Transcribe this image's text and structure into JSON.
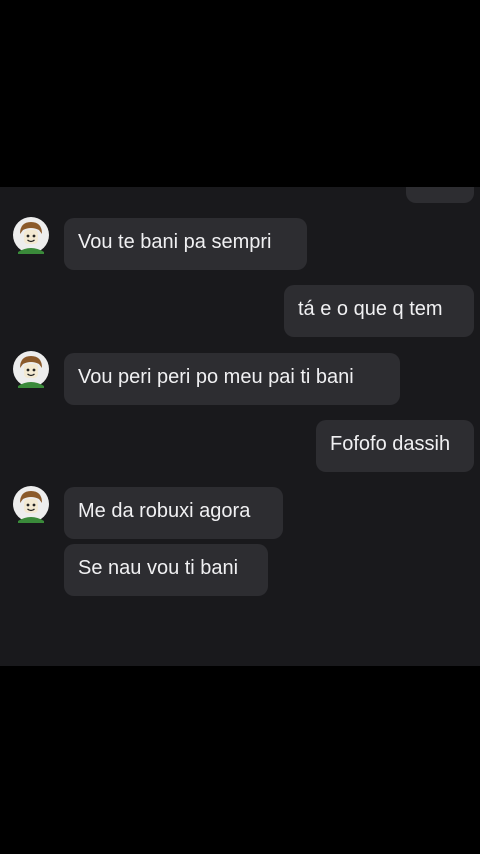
{
  "conversation": {
    "messages": [
      {
        "direction": "outgoing",
        "text": ""
      },
      {
        "direction": "incoming",
        "text": "Vou te bani pa sempri"
      },
      {
        "direction": "outgoing",
        "text": "tá e o que q tem"
      },
      {
        "direction": "incoming",
        "text": "Vou peri peri po meu pai ti bani"
      },
      {
        "direction": "outgoing",
        "text": "Fofofo dassih"
      },
      {
        "direction": "incoming",
        "text": "Me da robuxi agora"
      },
      {
        "direction": "incoming",
        "text": "Se nau vou ti bani"
      }
    ]
  },
  "avatar_icon": "roblox-avatar-icon",
  "colors": {
    "background": "#000000",
    "chat_background": "#19191c",
    "bubble": "#2d2d31",
    "text": "#f0f0f2"
  }
}
